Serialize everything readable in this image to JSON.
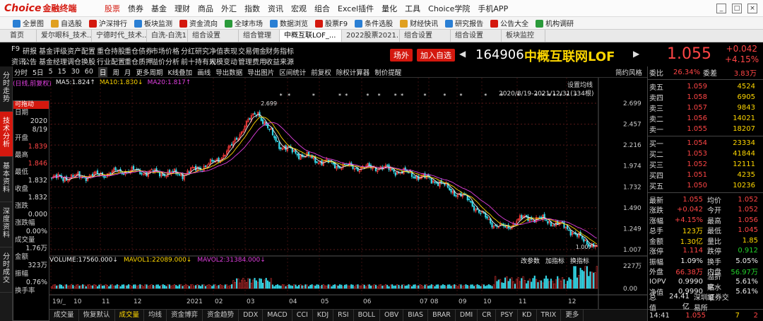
{
  "app": {
    "logo": "Choice",
    "logo_cn": "金融终端",
    "menu": [
      "股票",
      "债券",
      "基金",
      "理财",
      "商品",
      "外汇",
      "指数",
      "资讯",
      "宏观",
      "组合",
      "Excel插件",
      "量化",
      "工具",
      "Choice学院",
      "手机APP"
    ],
    "active_menu": "股票"
  },
  "toolbar": [
    "全景图",
    "自选股",
    "沪深排行",
    "板块监测",
    "资金流向",
    "全球市场",
    "数据浏览",
    "股票F9",
    "条件选股",
    "财经快讯",
    "研究报告",
    "公告大全",
    "机构调研"
  ],
  "tool_colors": [
    "#2a7fd4",
    "#e0a020",
    "#d4180e",
    "#2a7fd4",
    "#d4180e",
    "#2a9a3a",
    "#2a7fd4",
    "#d4180e",
    "#2a7fd4",
    "#e0a020",
    "#2a7fd4",
    "#d4180e",
    "#2a9a3a"
  ],
  "tabs": [
    "首页",
    "爱尔眼科_技术...",
    "宁德时代_技术...",
    "白洗-白洗1",
    "组合设置",
    "组合管理",
    "中概互联LOF_...",
    "2022股票2021...",
    "组合设置",
    "组合设置",
    "板块监控"
  ],
  "active_tab": 6,
  "header": {
    "row1": [
      "F9",
      "研报",
      "基金评级",
      "资产配置",
      "重仓持股",
      "重仓债券",
      "市场价格",
      "分红研究",
      "净值表现",
      "交易佣金",
      "财务指标"
    ],
    "row2": [
      "资讯",
      "公告",
      "基金经理",
      "调仓换股",
      "行业配置",
      "重仓质押",
      "溢价分析",
      "前十持有人",
      "规模变动",
      "管理费用",
      "收益来源"
    ],
    "btn_outside": "场外",
    "btn_add": "加入自选",
    "code": "164906",
    "name": "中概互联网LOF"
  },
  "quote": {
    "price": "1.055",
    "change": "+0.042",
    "pct": "+4.15%"
  },
  "chart_toolbar": [
    "分时",
    "5日",
    "5",
    "15",
    "30",
    "60",
    "日",
    "周",
    "月",
    "更多周期",
    "K线叠加",
    "画线",
    "导出数据",
    "导出图片",
    "区间统计",
    "前复权",
    "除权计算器",
    "制价提醒",
    "简约风格"
  ],
  "chart_toolbar_active": 6,
  "ma_legend": {
    "mode": "(日线,前复权)",
    "ma5": "MA5:1.824↑",
    "ma10": "MA10:1.830↓",
    "ma20": "MA20:1.817↑",
    "set_label": "设置均线",
    "range": "2020/8/19-2021/12/31(334根)"
  },
  "left_nav": [
    "分时走势",
    "技术分析",
    "基本资料",
    "深度资料",
    "分时成交"
  ],
  "left_nav_active": 1,
  "info": {
    "title": "可拖动",
    "rows": [
      [
        "日期",
        ""
      ],
      [
        "",
        "2020"
      ],
      [
        "",
        "8/19"
      ],
      [
        "开盘",
        ""
      ],
      [
        "",
        "1.839"
      ],
      [
        "最高",
        ""
      ],
      [
        "",
        "1.846"
      ],
      [
        "最低",
        ""
      ],
      [
        "",
        "1.832"
      ],
      [
        "收盘",
        ""
      ],
      [
        "",
        "1.832"
      ],
      [
        "涨跌",
        ""
      ],
      [
        "",
        "0.000"
      ],
      [
        "涨跌幅",
        ""
      ],
      [
        "",
        "0.00%"
      ],
      [
        "成交量",
        ""
      ],
      [
        "",
        "1.76万"
      ],
      [
        "金额",
        ""
      ],
      [
        "",
        "323万"
      ],
      [
        "振幅",
        ""
      ],
      [
        "",
        "0.76%"
      ],
      [
        "换手率",
        ""
      ]
    ]
  },
  "volume_legend": {
    "vol": "VOLUME:17560.000↓",
    "mavol1": "MAVOL1:22089.000↓",
    "mavol2": "MAVOL2:31384.000↓",
    "ops": [
      "改参数",
      "加指标",
      "换指标"
    ]
  },
  "chart_data": {
    "type": "candlestick",
    "title": "",
    "y_ticks": [
      2.699,
      2.457,
      2.216,
      1.974,
      1.732,
      1.49,
      1.249,
      1.007
    ],
    "ylim": [
      1.007,
      2.699
    ],
    "annotations": [
      {
        "label": "2.699",
        "kind": "high"
      },
      {
        "label": "1.007",
        "kind": "low"
      }
    ],
    "x_labels": [
      "19/_",
      "10",
      "11",
      "12",
      "2021",
      "02",
      "03",
      "04",
      "05",
      "06",
      "07",
      "08",
      "09",
      "10",
      "11",
      "12"
    ],
    "volume_ticks": [
      "227万",
      "0.00"
    ],
    "volume_max": 2270000,
    "close_anchors": [
      [
        0,
        1.83
      ],
      [
        25,
        1.86
      ],
      [
        45,
        1.92
      ],
      [
        60,
        1.9
      ],
      [
        80,
        1.88
      ],
      [
        100,
        2.02
      ],
      [
        110,
        2.2
      ],
      [
        118,
        2.45
      ],
      [
        126,
        2.6
      ],
      [
        132,
        2.4
      ],
      [
        140,
        2.2
      ],
      [
        150,
        2.12
      ],
      [
        160,
        2.05
      ],
      [
        175,
        1.98
      ],
      [
        190,
        1.95
      ],
      [
        200,
        1.96
      ],
      [
        215,
        1.9
      ],
      [
        235,
        1.8
      ],
      [
        245,
        1.68
      ],
      [
        255,
        1.58
      ],
      [
        262,
        1.42
      ],
      [
        270,
        1.3
      ],
      [
        278,
        1.25
      ],
      [
        284,
        1.35
      ],
      [
        292,
        1.38
      ],
      [
        300,
        1.35
      ],
      [
        310,
        1.3
      ],
      [
        318,
        1.22
      ],
      [
        325,
        1.1
      ],
      [
        333,
        1.055
      ]
    ]
  },
  "book": {
    "ratio": [
      "委比",
      "26.34%",
      "委差",
      "3.83万"
    ],
    "asks": [
      [
        "卖五",
        "1.059",
        "4524"
      ],
      [
        "卖四",
        "1.058",
        "6905"
      ],
      [
        "卖三",
        "1.057",
        "9843"
      ],
      [
        "卖二",
        "1.056",
        "14021"
      ],
      [
        "卖一",
        "1.055",
        "18207"
      ]
    ],
    "bids": [
      [
        "买一",
        "1.054",
        "23334"
      ],
      [
        "买二",
        "1.053",
        "41844"
      ],
      [
        "买三",
        "1.052",
        "12111"
      ],
      [
        "买四",
        "1.051",
        "4235"
      ],
      [
        "买五",
        "1.050",
        "10236"
      ]
    ],
    "stats": [
      [
        "最新",
        "1.055",
        "均价",
        "1.052",
        "red",
        "red"
      ],
      [
        "涨跌",
        "+0.042",
        "今开",
        "1.052",
        "red",
        "red"
      ],
      [
        "涨幅",
        "+4.15%",
        "最高",
        "1.056",
        "red",
        "red"
      ],
      [
        "总手",
        "123万",
        "最低",
        "1.045",
        "yel",
        "red"
      ],
      [
        "金额",
        "1.30亿",
        "量比",
        "1.85",
        "yel",
        "yel"
      ],
      [
        "涨停",
        "1.114",
        "跌停",
        "0.912",
        "red",
        "grn"
      ],
      [
        "振幅",
        "1.09%",
        "换手",
        "5.05%",
        "wht",
        "wht"
      ],
      [
        "外盘",
        "66.38万",
        "内盘",
        "56.97万",
        "red",
        "grn"
      ],
      [
        "IOPV",
        "0.9990",
        "溢折率",
        "5.61%",
        "wht",
        "wht"
      ],
      [
        "净值",
        "0.9990",
        "贴水率",
        "5.61%",
        "wht",
        "wht"
      ],
      [
        "总值",
        "24.41亿",
        "深圳证券交易所",
        "",
        "wht",
        "wht"
      ]
    ],
    "footer": [
      "14:41",
      "1.055",
      "7",
      "2"
    ]
  },
  "bottom_tabs": [
    "成交量",
    "恢复默认",
    "成交量",
    "均线",
    "资金博弈",
    "资金趋势",
    "DDX",
    "MACD",
    "CCI",
    "KDJ",
    "RSI",
    "BOLL",
    "OBV",
    "BIAS",
    "BRAR",
    "DMI",
    "CR",
    "PSY",
    "KD",
    "TRIX",
    "更多"
  ],
  "bottom_active": 2
}
